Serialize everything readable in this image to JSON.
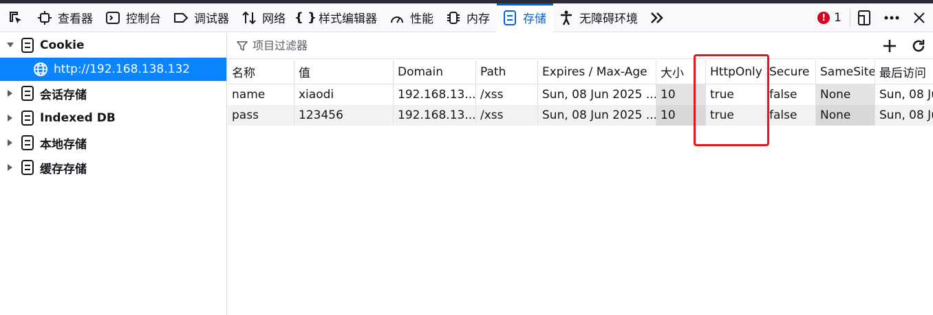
{
  "toolbar": {
    "tabs": [
      {
        "label": "查看器",
        "icon": "inspector-icon"
      },
      {
        "label": "控制台",
        "icon": "console-icon"
      },
      {
        "label": "调试器",
        "icon": "debugger-icon"
      },
      {
        "label": "网络",
        "icon": "network-icon"
      },
      {
        "label": "样式编辑器",
        "icon": "style-editor-icon"
      },
      {
        "label": "性能",
        "icon": "performance-icon"
      },
      {
        "label": "内存",
        "icon": "memory-icon"
      },
      {
        "label": "存储",
        "icon": "storage-icon",
        "selected": true
      },
      {
        "label": "无障碍环境",
        "icon": "accessibility-icon"
      }
    ],
    "error_count": "1"
  },
  "sidebar": {
    "items": [
      {
        "label": "Cookie",
        "expanded": true
      },
      {
        "label": "http://192.168.138.132",
        "selected": true
      },
      {
        "label": "会话存储"
      },
      {
        "label": "Indexed DB"
      },
      {
        "label": "本地存储"
      },
      {
        "label": "缓存存储"
      }
    ]
  },
  "filter": {
    "placeholder": "项目过滤器"
  },
  "table": {
    "columns": [
      "名称",
      "值",
      "Domain",
      "Path",
      "Expires / Max-Age",
      "大小",
      "HttpOnly",
      "Secure",
      "SameSite",
      "最后访问"
    ],
    "rows": [
      [
        "name",
        "xiaodi",
        "192.168.13...",
        "/xss",
        "Sun, 08 Jun 2025 ...",
        "10",
        "true",
        "false",
        "None",
        "Sun, 08 Ju"
      ],
      [
        "pass",
        "123456",
        "192.168.13...",
        "/xss",
        "Sun, 08 Jun 2025 ...",
        "10",
        "true",
        "false",
        "None",
        "Sun, 08 Ju"
      ]
    ]
  },
  "colors": {
    "accent": "#0061e0",
    "selection": "#0a84ff",
    "highlight_box": "#e8151b",
    "error": "#d70022"
  }
}
